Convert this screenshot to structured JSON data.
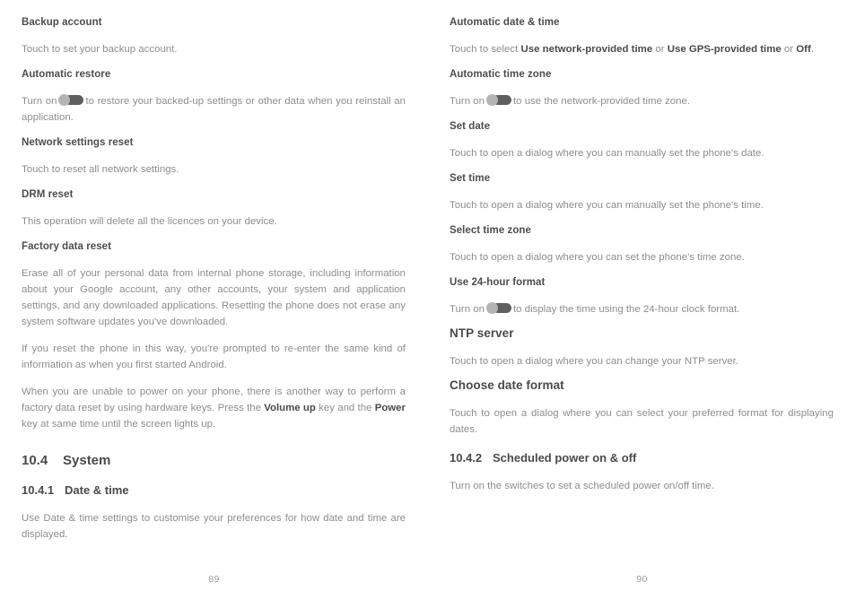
{
  "document": {
    "type": "user-manual-spread",
    "colors": {
      "heading": "#4a4a4a",
      "body": "#8d8d8d",
      "page_number": "#9a9a9a",
      "toggle_knob": "#b4b4b4",
      "toggle_track": "#5f5f5f",
      "background": "#ffffff"
    }
  },
  "left_page": {
    "page_number": "89",
    "backup_account": {
      "heading": "Backup account",
      "body": "Touch to set your backup account."
    },
    "automatic_restore": {
      "heading": "Automatic restore",
      "body_before_toggle": "Turn on",
      "body_after_toggle": "to restore your backed-up settings or other data when you reinstall an application.",
      "toggle_icon": "toggle-switch-icon"
    },
    "network_settings_reset": {
      "heading": "Network settings reset",
      "body": "Touch to reset all network settings."
    },
    "drm_reset": {
      "heading": "DRM reset",
      "body": "This operation will delete all the licences on your device."
    },
    "factory_data_reset": {
      "heading": "Factory data reset",
      "paragraph_1": "Erase all of your personal data from internal phone storage, including information about your Google account, any other accounts, your system and application settings, and any downloaded applications. Resetting the phone does not erase any system software updates you've downloaded.",
      "paragraph_2": "If you reset the phone in this way, you're prompted to re-enter the same kind of information as when you first started Android.",
      "paragraph_3_part_1": "When you are unable to power on your phone, there is another way to perform a factory data reset by using hardware keys. Press the ",
      "paragraph_3_bold_1": "Volume up",
      "paragraph_3_part_2": " key and the ",
      "paragraph_3_bold_2": "Power",
      "paragraph_3_part_3": " key at same time until the screen lights up."
    },
    "system_section": {
      "number": "10.4",
      "title": "System"
    },
    "date_time_section": {
      "number": "10.4.1",
      "title": "Date & time",
      "body": "Use Date & time settings to customise your preferences for how date and time are displayed."
    }
  },
  "right_page": {
    "page_number": "90",
    "automatic_date_time": {
      "heading": "Automatic date & time",
      "body_part_1": "Touch to select ",
      "body_bold_1": "Use network-provided time",
      "body_part_2": " or ",
      "body_bold_2": "Use GPS-provided time",
      "body_part_3": " or ",
      "body_bold_3": "Off",
      "body_part_4": "."
    },
    "automatic_time_zone": {
      "heading": "Automatic time zone",
      "body_before_toggle": "Turn on",
      "body_after_toggle": "to use the network-provided time zone.",
      "toggle_icon": "toggle-switch-icon"
    },
    "set_date": {
      "heading": "Set date",
      "body": "Touch to open a dialog where you can manually set the phone's date."
    },
    "set_time": {
      "heading": "Set time",
      "body": "Touch to open a dialog where you can manually set the phone's time."
    },
    "select_time_zone": {
      "heading": "Select time zone",
      "body": "Touch to open a dialog where you can set the phone's time zone."
    },
    "use_24_hour_format": {
      "heading": "Use 24-hour format",
      "body_before_toggle": "Turn on",
      "body_after_toggle": "to display the time using the 24-hour clock format.",
      "toggle_icon": "toggle-switch-icon"
    },
    "ntp_server": {
      "heading": "NTP server",
      "body": "Touch to open a dialog where you can change your NTP server."
    },
    "choose_date_format": {
      "heading": "Choose date format",
      "body": "Touch to open a dialog where you can select your preferred format for displaying dates."
    },
    "scheduled_power": {
      "number": "10.4.2",
      "title": "Scheduled power on & off",
      "body": "Turn on the switches to set a scheduled power on/off time."
    }
  }
}
